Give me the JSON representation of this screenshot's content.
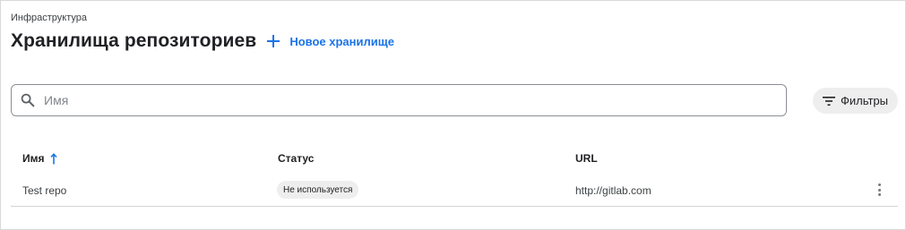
{
  "breadcrumb": "Инфраструктура",
  "header": {
    "title": "Хранилища репозиториев",
    "new_button_label": "Новое хранилище"
  },
  "search": {
    "placeholder": "Имя",
    "value": ""
  },
  "filters": {
    "label": "Фильтры"
  },
  "table": {
    "columns": {
      "name": "Имя",
      "status": "Статус",
      "url": "URL"
    },
    "sort": {
      "column": "name",
      "direction": "asc"
    },
    "rows": [
      {
        "name": "Test repo",
        "status": "Не используется",
        "url": "http://gitlab.com"
      }
    ]
  },
  "colors": {
    "accent": "#1a73e8",
    "text": "#202124",
    "badge_bg": "#eeeeee"
  }
}
